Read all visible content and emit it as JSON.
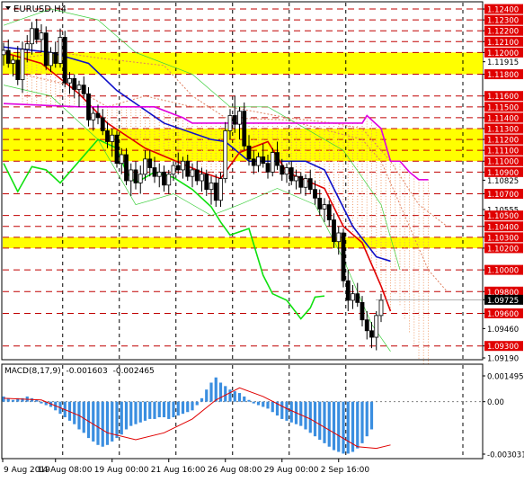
{
  "chart_data": [
    {
      "type": "candlestick",
      "title": "EURUSD,H4",
      "ylim": [
        1.0919,
        1.1245
      ],
      "price_labels": [
        {
          "value": 1.124,
          "label": "1.12400",
          "kind": "red"
        },
        {
          "value": 1.123,
          "label": "1.12300",
          "kind": "red"
        },
        {
          "value": 1.122,
          "label": "1.12200",
          "kind": "red"
        },
        {
          "value": 1.121,
          "label": "1.12100",
          "kind": "red"
        },
        {
          "value": 1.12,
          "label": "1.12000",
          "kind": "red"
        },
        {
          "value": 1.11915,
          "label": "1.11915",
          "kind": "plain"
        },
        {
          "value": 1.118,
          "label": "1.11800",
          "kind": "red"
        },
        {
          "value": 1.116,
          "label": "1.11600",
          "kind": "red"
        },
        {
          "value": 1.115,
          "label": "1.11500",
          "kind": "red"
        },
        {
          "value": 1.114,
          "label": "1.11400",
          "kind": "red"
        },
        {
          "value": 1.113,
          "label": "1.11300",
          "kind": "red"
        },
        {
          "value": 1.112,
          "label": "1.11200",
          "kind": "red"
        },
        {
          "value": 1.111,
          "label": "1.11100",
          "kind": "red"
        },
        {
          "value": 1.11,
          "label": "1.11000",
          "kind": "red"
        },
        {
          "value": 1.109,
          "label": "1.10900",
          "kind": "red"
        },
        {
          "value": 1.10825,
          "label": "1.10825",
          "kind": "plain"
        },
        {
          "value": 1.107,
          "label": "1.10700",
          "kind": "red"
        },
        {
          "value": 1.10555,
          "label": "1.10555",
          "kind": "plain"
        },
        {
          "value": 1.105,
          "label": "1.10500",
          "kind": "red"
        },
        {
          "value": 1.104,
          "label": "1.10400",
          "kind": "red"
        },
        {
          "value": 1.103,
          "label": "1.10300",
          "kind": "red"
        },
        {
          "value": 1.102,
          "label": "1.10200",
          "kind": "red"
        },
        {
          "value": 1.1,
          "label": "1.10000",
          "kind": "red"
        },
        {
          "value": 1.098,
          "label": "1.09800",
          "kind": "red"
        },
        {
          "value": 1.09725,
          "label": "1.09725",
          "kind": "current"
        },
        {
          "value": 1.096,
          "label": "1.09600",
          "kind": "red"
        },
        {
          "value": 1.0946,
          "label": "1.09460",
          "kind": "plain"
        },
        {
          "value": 1.093,
          "label": "1.09300",
          "kind": "red"
        },
        {
          "value": 1.0919,
          "label": "1.09190",
          "kind": "plain"
        }
      ],
      "dashed_levels": [
        1.124,
        1.123,
        1.122,
        1.121,
        1.12,
        1.118,
        1.116,
        1.115,
        1.114,
        1.113,
        1.112,
        1.111,
        1.11,
        1.109,
        1.107,
        1.105,
        1.104,
        1.103,
        1.102,
        1.1,
        1.098,
        1.096,
        1.093
      ],
      "yellow_zones": [
        [
          1.118,
          1.12
        ],
        [
          1.11,
          1.113
        ],
        [
          1.102,
          1.103
        ]
      ],
      "x_labels": [
        "9 Aug 2019",
        "14 Aug 08:00",
        "19 Aug 00:00",
        "21 Aug 16:00",
        "26 Aug 08:00",
        "29 Aug 00:00",
        "2 Sep 16:00"
      ],
      "ohlc": [
        [
          1.1198,
          1.1209,
          1.1188,
          1.1202
        ],
        [
          1.1202,
          1.1212,
          1.1186,
          1.119
        ],
        [
          1.119,
          1.1197,
          1.1178,
          1.1193
        ],
        [
          1.1193,
          1.1206,
          1.117,
          1.1175
        ],
        [
          1.1175,
          1.121,
          1.1163,
          1.1203
        ],
        [
          1.1203,
          1.1216,
          1.1191,
          1.1208
        ],
        [
          1.1208,
          1.1228,
          1.1198,
          1.1222
        ],
        [
          1.1222,
          1.1231,
          1.1208,
          1.1212
        ],
        [
          1.1212,
          1.1226,
          1.12,
          1.1218
        ],
        [
          1.1218,
          1.1224,
          1.1184,
          1.1188
        ],
        [
          1.1188,
          1.1205,
          1.1182,
          1.12
        ],
        [
          1.12,
          1.121,
          1.1186,
          1.119
        ],
        [
          1.119,
          1.1222,
          1.1186,
          1.1214
        ],
        [
          1.1214,
          1.122,
          1.1168,
          1.1172
        ],
        [
          1.1172,
          1.1182,
          1.1162,
          1.1176
        ],
        [
          1.1176,
          1.118,
          1.1158,
          1.1166
        ],
        [
          1.1166,
          1.1174,
          1.115,
          1.117
        ],
        [
          1.117,
          1.1178,
          1.1158,
          1.1162
        ],
        [
          1.1162,
          1.1168,
          1.1132,
          1.1138
        ],
        [
          1.1138,
          1.115,
          1.1128,
          1.1144
        ],
        [
          1.1144,
          1.1152,
          1.1134,
          1.114
        ],
        [
          1.114,
          1.1148,
          1.1124,
          1.1128
        ],
        [
          1.1128,
          1.1136,
          1.1112,
          1.1118
        ],
        [
          1.1118,
          1.113,
          1.1104,
          1.1124
        ],
        [
          1.1124,
          1.1128,
          1.1094,
          1.1098
        ],
        [
          1.1098,
          1.1112,
          1.1088,
          1.1106
        ],
        [
          1.1106,
          1.1112,
          1.1078,
          1.1082
        ],
        [
          1.1082,
          1.1098,
          1.1068,
          1.1092
        ],
        [
          1.1092,
          1.11,
          1.1074,
          1.108
        ],
        [
          1.108,
          1.1096,
          1.107,
          1.1088
        ],
        [
          1.1088,
          1.111,
          1.1082,
          1.1102
        ],
        [
          1.1102,
          1.111,
          1.1086,
          1.1094
        ],
        [
          1.1094,
          1.1104,
          1.108,
          1.1086
        ],
        [
          1.1086,
          1.1098,
          1.1076,
          1.109
        ],
        [
          1.109,
          1.1096,
          1.1072,
          1.1078
        ],
        [
          1.1078,
          1.1092,
          1.107,
          1.1088
        ],
        [
          1.1088,
          1.11,
          1.1082,
          1.1096
        ],
        [
          1.1096,
          1.1108,
          1.1088,
          1.1092
        ],
        [
          1.1092,
          1.1104,
          1.1084,
          1.11
        ],
        [
          1.11,
          1.1106,
          1.1082,
          1.1086
        ],
        [
          1.1086,
          1.1098,
          1.1076,
          1.1092
        ],
        [
          1.1092,
          1.11,
          1.1078,
          1.1082
        ],
        [
          1.1082,
          1.1094,
          1.1072,
          1.1088
        ],
        [
          1.1088,
          1.1092,
          1.1068,
          1.1074
        ],
        [
          1.1074,
          1.1086,
          1.106,
          1.108
        ],
        [
          1.108,
          1.1088,
          1.1058,
          1.1064
        ],
        [
          1.1064,
          1.109,
          1.1058,
          1.1084
        ],
        [
          1.1084,
          1.1136,
          1.108,
          1.1128
        ],
        [
          1.1128,
          1.1148,
          1.112,
          1.1142
        ],
        [
          1.1142,
          1.116,
          1.1126,
          1.1134
        ],
        [
          1.1134,
          1.115,
          1.112,
          1.1146
        ],
        [
          1.1146,
          1.1154,
          1.111,
          1.1114
        ],
        [
          1.1114,
          1.1124,
          1.1096,
          1.1102
        ],
        [
          1.1102,
          1.111,
          1.1088,
          1.1096
        ],
        [
          1.1096,
          1.1108,
          1.109,
          1.1104
        ],
        [
          1.1104,
          1.1116,
          1.1094,
          1.1098
        ],
        [
          1.1098,
          1.1106,
          1.1084,
          1.109
        ],
        [
          1.109,
          1.1112,
          1.1086,
          1.1108
        ],
        [
          1.1108,
          1.1118,
          1.1092,
          1.1096
        ],
        [
          1.1096,
          1.1102,
          1.1082,
          1.1088
        ],
        [
          1.1088,
          1.1098,
          1.108,
          1.1094
        ],
        [
          1.1094,
          1.11,
          1.1078,
          1.1082
        ],
        [
          1.1082,
          1.1092,
          1.1074,
          1.1086
        ],
        [
          1.1086,
          1.109,
          1.107,
          1.1076
        ],
        [
          1.1076,
          1.1088,
          1.1068,
          1.1084
        ],
        [
          1.1084,
          1.1092,
          1.107,
          1.1074
        ],
        [
          1.1074,
          1.1082,
          1.106,
          1.1066
        ],
        [
          1.1066,
          1.1074,
          1.105,
          1.1056
        ],
        [
          1.1056,
          1.1066,
          1.1044,
          1.106
        ],
        [
          1.106,
          1.1064,
          1.104,
          1.1046
        ],
        [
          1.1046,
          1.1052,
          1.102,
          1.1026
        ],
        [
          1.1026,
          1.104,
          1.1014,
          1.1034
        ],
        [
          1.1034,
          1.1038,
          1.0984,
          1.099
        ],
        [
          1.099,
          1.1,
          1.0962,
          1.0972
        ],
        [
          1.0972,
          1.0986,
          1.0964,
          1.0978
        ],
        [
          1.0978,
          1.0988,
          1.0966,
          1.097
        ],
        [
          1.097,
          1.0976,
          1.0948,
          1.0954
        ],
        [
          1.0954,
          1.0962,
          1.0936,
          1.0944
        ],
        [
          1.0944,
          1.0952,
          1.0928,
          1.0938
        ],
        [
          1.0938,
          1.0962,
          1.0926,
          1.0958
        ],
        [
          1.0958,
          1.0978,
          1.0952,
          1.0972
        ]
      ],
      "series": [
        {
          "color": "#1010c8",
          "values": [
            [
              0,
              1.1205
            ],
            [
              10,
              1.12
            ],
            [
              18,
              1.119
            ],
            [
              24,
              1.1165
            ],
            [
              34,
              1.1135
            ],
            [
              44,
              1.112
            ],
            [
              47,
              1.1118
            ],
            [
              52,
              1.11
            ],
            [
              64,
              1.11
            ],
            [
              68,
              1.1092
            ],
            [
              74,
              1.104
            ],
            [
              79,
              1.1012
            ],
            [
              82,
              1.1008
            ]
          ]
        },
        {
          "color": "#e00000",
          "values": [
            [
              0,
              1.12
            ],
            [
              8,
              1.119
            ],
            [
              16,
              1.1162
            ],
            [
              22,
              1.1135
            ],
            [
              30,
              1.1112
            ],
            [
              42,
              1.109
            ],
            [
              46,
              1.1084
            ],
            [
              50,
              1.1108
            ],
            [
              56,
              1.1118
            ],
            [
              60,
              1.109
            ],
            [
              68,
              1.1075
            ],
            [
              72,
              1.104
            ],
            [
              76,
              1.1025
            ],
            [
              80,
              1.0985
            ],
            [
              82,
              1.0962
            ]
          ]
        },
        {
          "color": "#e000e0",
          "values": [
            [
              0,
              1.1153
            ],
            [
              16,
              1.115
            ],
            [
              32,
              1.115
            ],
            [
              38,
              1.114
            ],
            [
              40,
              1.1135
            ],
            [
              70,
              1.1135
            ],
            [
              76,
              1.1135
            ],
            [
              77,
              1.1142
            ],
            [
              80,
              1.113
            ],
            [
              82,
              1.11
            ],
            [
              84,
              1.11
            ],
            [
              86,
              1.109
            ],
            [
              88,
              1.1083
            ],
            [
              90,
              1.1083
            ]
          ]
        },
        {
          "color": "#10e010",
          "values": [
            [
              0,
              1.1098
            ],
            [
              3,
              1.1072
            ],
            [
              6,
              1.1095
            ],
            [
              9,
              1.1092
            ],
            [
              12,
              1.108
            ],
            [
              15,
              1.1095
            ],
            [
              20,
              1.112
            ],
            [
              24,
              1.1112
            ],
            [
              26,
              1.109
            ],
            [
              28,
              1.108
            ],
            [
              32,
              1.109
            ],
            [
              36,
              1.1085
            ],
            [
              40,
              1.1074
            ],
            [
              44,
              1.1058
            ],
            [
              46,
              1.1044
            ],
            [
              48,
              1.1032
            ],
            [
              52,
              1.1038
            ],
            [
              55,
              1.0995
            ],
            [
              57,
              1.0978
            ],
            [
              60,
              1.0972
            ],
            [
              63,
              1.0955
            ],
            [
              65,
              1.0965
            ],
            [
              66,
              1.0975
            ],
            [
              68,
              1.0976
            ]
          ]
        }
      ]
    },
    {
      "type": "bar",
      "title": "MACD(8,17,9)",
      "macd_value": "-0.001603",
      "signal_value": "-0.002465",
      "ylim": [
        -0.00303,
        0.00149
      ],
      "y_labels": [
        {
          "value": 0.00149,
          "label": "0.001495"
        },
        {
          "value": 0.0,
          "label": "0.00"
        },
        {
          "value": -0.00303,
          "label": "-0.003031"
        }
      ],
      "histogram": [
        0.0003,
        0.0002,
        0.0001,
        0.0002,
        0.0002,
        0.0003,
        0.0002,
        0.0001,
        -0.0001,
        -0.0002,
        -0.0003,
        -0.0005,
        -0.0007,
        -0.0009,
        -0.0011,
        -0.0013,
        -0.0016,
        -0.0018,
        -0.0021,
        -0.0023,
        -0.0025,
        -0.0026,
        -0.0025,
        -0.0023,
        -0.0021,
        -0.0019,
        -0.0016,
        -0.0014,
        -0.0013,
        -0.0012,
        -0.0011,
        -0.001,
        -0.001,
        -0.0009,
        -0.0009,
        -0.001,
        -0.0009,
        -0.0008,
        -0.0007,
        -0.0006,
        -0.0005,
        -0.0002,
        0.0002,
        0.0007,
        0.0011,
        0.0014,
        0.0011,
        0.0009,
        0.0007,
        0.0006,
        0.0005,
        0.0003,
        0.0001,
        -0.0001,
        -0.0002,
        -0.0003,
        -0.0004,
        -0.0006,
        -0.0008,
        -0.001,
        -0.0011,
        -0.0012,
        -0.0013,
        -0.0014,
        -0.0016,
        -0.0018,
        -0.002,
        -0.0022,
        -0.0024,
        -0.0026,
        -0.0028,
        -0.0029,
        -0.003,
        -0.003,
        -0.0029,
        -0.0027,
        -0.0024,
        -0.002,
        -0.0016
      ],
      "signal": [
        [
          0,
          0.0002
        ],
        [
          8,
          0.0001
        ],
        [
          16,
          -0.0008
        ],
        [
          22,
          -0.0018
        ],
        [
          28,
          -0.0022
        ],
        [
          34,
          -0.0018
        ],
        [
          40,
          -0.001
        ],
        [
          45,
          0.0001
        ],
        [
          50,
          0.0008
        ],
        [
          55,
          0.0003
        ],
        [
          60,
          -0.0004
        ],
        [
          65,
          -0.001
        ],
        [
          70,
          -0.0018
        ],
        [
          75,
          -0.0026
        ],
        [
          79,
          -0.0027
        ],
        [
          82,
          -0.0025
        ]
      ]
    }
  ]
}
